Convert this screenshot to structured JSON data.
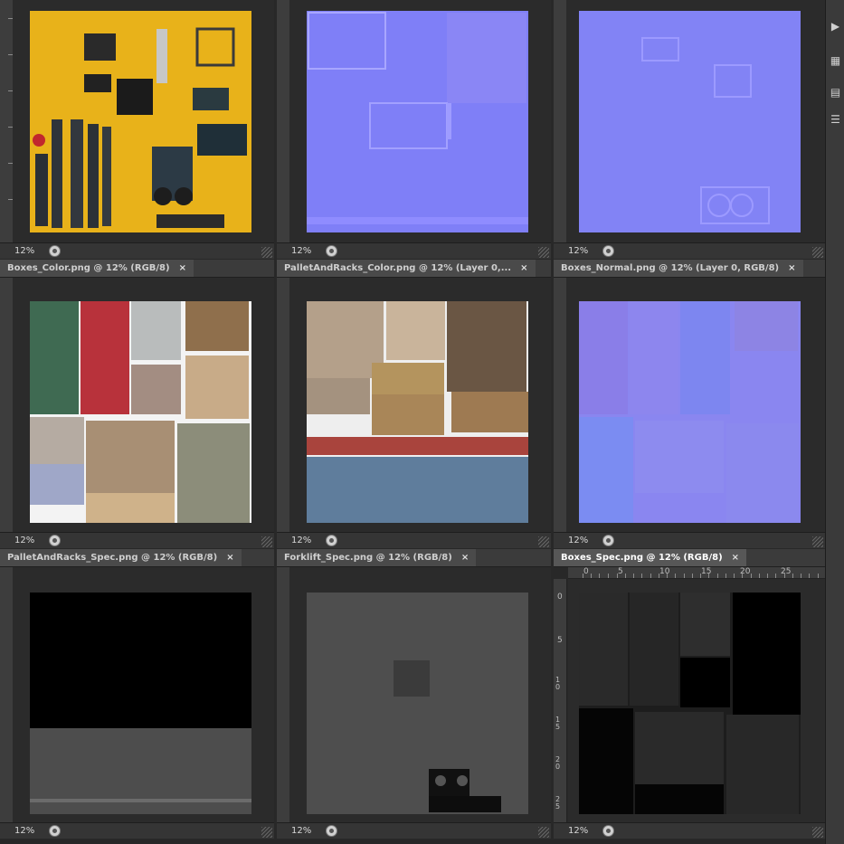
{
  "zoom_label": "12%",
  "panels": [
    {
      "id": "forklift-color",
      "tab": "",
      "active": false
    },
    {
      "id": "forklift-normal",
      "tab": "",
      "active": false
    },
    {
      "id": "pallet-normal",
      "tab": "",
      "active": false
    },
    {
      "id": "boxes-color",
      "tab": "Boxes_Color.png @ 12% (RGB/8)",
      "active": false
    },
    {
      "id": "pallet-color",
      "tab": "PalletAndRacks_Color.png @ 12% (Layer 0,...",
      "active": false
    },
    {
      "id": "boxes-normal",
      "tab": "Boxes_Normal.png @ 12% (Layer 0, RGB/8)",
      "active": false
    },
    {
      "id": "pallet-spec",
      "tab": "PalletAndRacks_Spec.png @ 12% (RGB/8)",
      "active": false
    },
    {
      "id": "forklift-spec",
      "tab": "Forklift_Spec.png @ 12% (RGB/8)",
      "active": false
    },
    {
      "id": "boxes-spec",
      "tab": "Boxes_Spec.png @ 12% (RGB/8)",
      "active": true
    }
  ],
  "ruler_top_labels": [
    "0",
    "5",
    "10",
    "15",
    "20",
    "25"
  ],
  "ruler_left_labels": [
    "0",
    "5",
    "10",
    "15",
    "20",
    "25"
  ],
  "icons": {
    "close": "×",
    "play": "▶",
    "tool1": "▦",
    "tool2": "▤",
    "tool3": "☰"
  },
  "colors": {
    "tab_active": "#575757",
    "tab_inactive": "#4a4a4a",
    "normal_map": "#7f7ff7",
    "forklift_yellow": "#e8b21a"
  }
}
